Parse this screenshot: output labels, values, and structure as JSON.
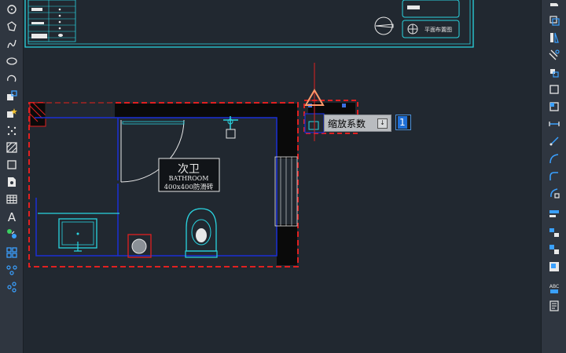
{
  "left_toolbar": {
    "tools": [
      "circle-icon",
      "polygon-icon",
      "polyline-icon",
      "ellipse-icon",
      "arc-icon",
      "block-insert-icon",
      "make-block-icon",
      "point-icon",
      "hatch-icon",
      "region-icon",
      "wipeout-icon",
      "table-icon",
      "multiline-text-icon",
      "add-selected-icon",
      "array-icon",
      "group-icon"
    ],
    "text_tool_glyph": "A"
  },
  "right_toolbar": {
    "tools": [
      "erase-icon",
      "copy-icon",
      "mirror-icon",
      "offset-icon",
      "move-icon",
      "rotate-icon",
      "scale-icon",
      "stretch-icon",
      "trim-icon",
      "extend-icon",
      "break-icon",
      "join-icon",
      "chamfer-icon",
      "fillet-icon",
      "blend-icon",
      "align-icon",
      "draw-order-icon",
      "bring-front-icon",
      "send-back-icon",
      "text-front-icon",
      "explode-icon",
      "spell-check-icon",
      "properties-icon"
    ],
    "spell_glyph": "ABC"
  },
  "drawing": {
    "room_name": "次卫",
    "room_name_en": "BATHROOM",
    "room_spec": "400x400防滑砖",
    "legend_button_label": "平面布置图"
  },
  "dynamic_input": {
    "prompt_label": "缩放系数",
    "value": "1"
  },
  "colors": {
    "background": "#212830",
    "selection": "#e02020",
    "walls": "#1a2fd6",
    "fixtures": "#2ad4e0",
    "grips": "#3a6fe0"
  }
}
